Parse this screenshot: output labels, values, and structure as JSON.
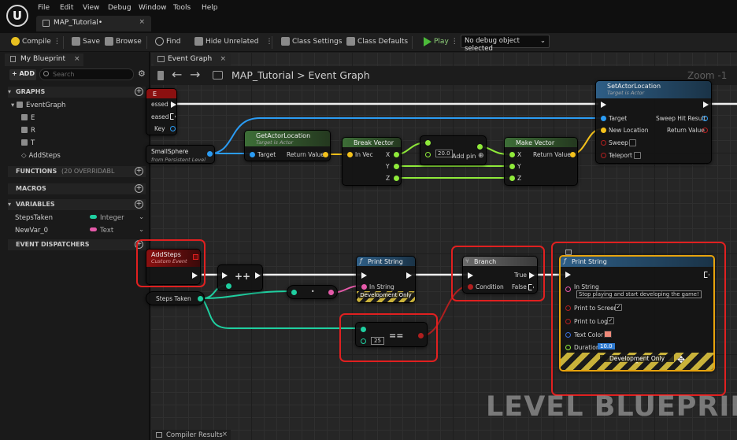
{
  "app": {
    "logo": "U",
    "doc_tab": "MAP_Tutorial•",
    "doc_tab_close": "×"
  },
  "menu": [
    "File",
    "Edit",
    "View",
    "Debug",
    "Window",
    "Tools",
    "Help"
  ],
  "toolbar": {
    "compile": "Compile",
    "save": "Save",
    "browse": "Browse",
    "find": "Find",
    "hide_unrelated": "Hide Unrelated",
    "class_settings": "Class Settings",
    "class_defaults": "Class Defaults",
    "play": "Play",
    "debug_object": "No debug object selected"
  },
  "left_panel": {
    "tab": "My Blueprint",
    "tab_close": "×",
    "add": "+ ADD",
    "search_placeholder": "Search",
    "sections": {
      "graphs": "GRAPHS",
      "functions": "FUNCTIONS",
      "functions_note": "(20 OVERRIDABL",
      "macros": "MACROS",
      "variables": "VARIABLES",
      "dispatchers": "EVENT DISPATCHERS"
    },
    "graph_items": [
      "EventGraph",
      "E",
      "R",
      "T",
      "AddSteps"
    ],
    "variables": [
      {
        "name": "StepsTaken",
        "type": "Integer",
        "color": "#1fcfa0"
      },
      {
        "name": "NewVar_0",
        "type": "Text",
        "color": "#e55aa9"
      }
    ]
  },
  "graph": {
    "tab": "Event Graph",
    "tab_close": "×",
    "breadcrumb_map": "MAP_Tutorial",
    "breadcrumb_sep": ">",
    "breadcrumb_graph": "Event Graph",
    "zoom": "Zoom -1",
    "watermark": "LEVEL BLUEPRINT",
    "compiler_tab": "Compiler Results"
  },
  "nodes": {
    "event_e": {
      "title": "E",
      "pins": [
        "essed",
        "eased",
        "Key"
      ]
    },
    "small_sphere": {
      "title": "SmallSphere",
      "sub": "from Persistent Level"
    },
    "get_actor_location": {
      "title": "GetActorLocation",
      "sub": "Target is Actor",
      "in": "Target",
      "out": "Return Value"
    },
    "break_vector": {
      "title": "Break Vector",
      "in": "In Vec",
      "outs": [
        "X",
        "Y",
        "Z"
      ]
    },
    "add_node": {
      "value": "20.0",
      "add_pin": "Add pin"
    },
    "make_vector": {
      "title": "Make Vector",
      "ins": [
        "X",
        "Y",
        "Z"
      ],
      "out": "Return Value"
    },
    "set_actor_location": {
      "title": "SetActorLocation",
      "sub": "Target is Actor",
      "pins": [
        "Target",
        "New Location",
        "Sweep",
        "Teleport"
      ],
      "outs": [
        "Sweep Hit Result",
        "Return Value"
      ]
    },
    "add_steps": {
      "title": "AddSteps",
      "sub": "Custom Event"
    },
    "increment": {
      "label": "++"
    },
    "steps_taken": {
      "label": "Steps Taken"
    },
    "to_string": {
      "label": "•"
    },
    "print_string_small": {
      "title": "Print String",
      "pin": "In String",
      "footer": "Development Only"
    },
    "equals": {
      "value": "25",
      "op": "=="
    },
    "branch": {
      "title": "Branch",
      "condition": "Condition",
      "true": "True",
      "false": "False"
    },
    "print_string_big": {
      "title": "Print String",
      "in_string": "In String",
      "message": "Stop playing and start developing the game!",
      "print_screen": "Print to Screen",
      "print_log": "Print to Log",
      "text_color": "Text Color",
      "duration": "Duration",
      "duration_value": "10.0",
      "footer": "Development Only",
      "check": "✓"
    }
  },
  "colors": {
    "exec": "#f2f2f2",
    "vector": "#f4c21c",
    "float": "#8fea3a",
    "object": "#2b9cf4",
    "int": "#1fcfa0",
    "string": "#e55aa9",
    "bool": "#b01f1f",
    "annotation": "#e02020"
  }
}
